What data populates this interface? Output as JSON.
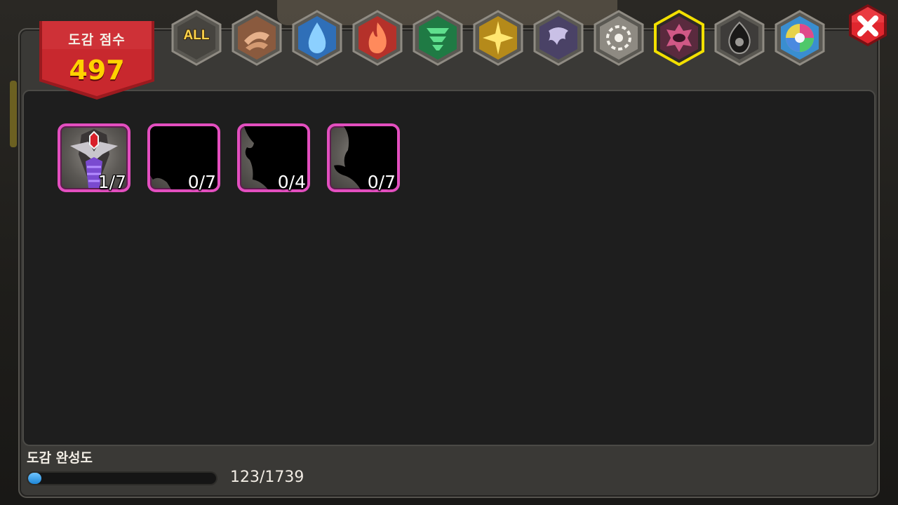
{
  "score": {
    "label": "도감 점수",
    "value": "497"
  },
  "tabs": [
    {
      "id": "all",
      "text": "ALL",
      "icon": "all-icon",
      "color": "#b9a98a",
      "selected": false
    },
    {
      "id": "earth",
      "icon": "earth-rock-icon",
      "color": "#d6a27a",
      "selected": false
    },
    {
      "id": "water",
      "icon": "water-drop-icon",
      "color": "#3f8fd8",
      "selected": false
    },
    {
      "id": "fire",
      "icon": "fire-flame-icon",
      "color": "#e0453a",
      "selected": false
    },
    {
      "id": "wind",
      "icon": "wind-tornado-icon",
      "color": "#2fae5f",
      "selected": false
    },
    {
      "id": "light",
      "icon": "light-sun-icon",
      "color": "#f2c230",
      "selected": false
    },
    {
      "id": "dark",
      "icon": "dark-dragon-icon",
      "color": "#7a6f9e",
      "selected": false
    },
    {
      "id": "holy",
      "icon": "holy-burst-icon",
      "color": "#e8e4dc",
      "selected": false
    },
    {
      "id": "chaos",
      "icon": "chaos-eye-icon",
      "color": "#d05886",
      "selected": true
    },
    {
      "id": "void",
      "icon": "void-flame-icon",
      "color": "#8a8a8a",
      "selected": false
    },
    {
      "id": "rainbow",
      "icon": "rainbow-swirl-icon",
      "color": "#4fb8d8",
      "selected": false
    }
  ],
  "cards": [
    {
      "count": "1/7",
      "revealed": true
    },
    {
      "count": "0/7",
      "revealed": false
    },
    {
      "count": "0/4",
      "revealed": false
    },
    {
      "count": "0/7",
      "revealed": false
    }
  ],
  "completion": {
    "label": "도감 완성도",
    "text": "123/1739",
    "current": 123,
    "total": 1739
  },
  "colors": {
    "banner": "#c0262c",
    "card_border": "#e34fbf",
    "selected_glow": "#f2e000",
    "progress": "#1e86d6",
    "close": "#e0262e"
  }
}
